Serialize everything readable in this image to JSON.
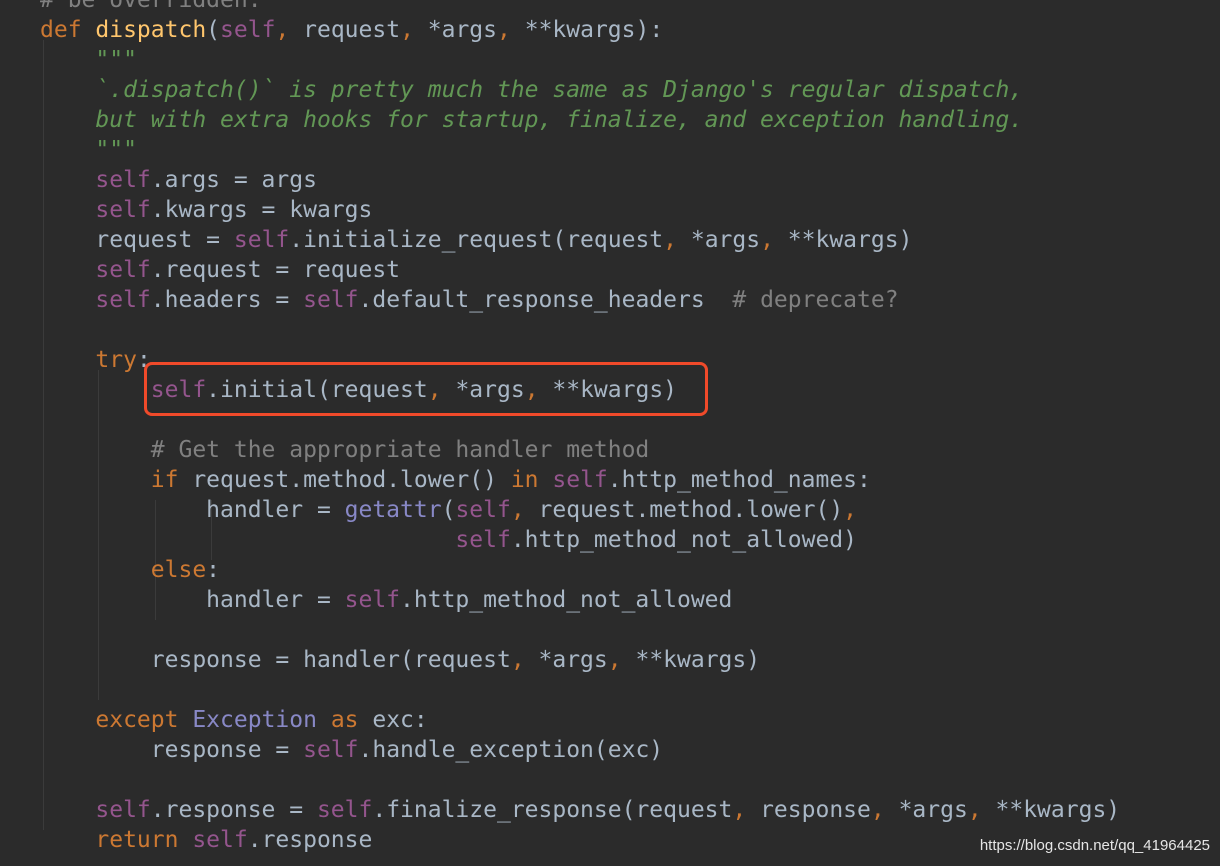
{
  "code_lines": [
    {
      "tokens": [
        {
          "t": "# be overridden.",
          "c": "cm"
        }
      ]
    },
    {
      "tokens": [
        {
          "t": "def ",
          "c": "kw"
        },
        {
          "t": "dispatch",
          "c": "fn"
        },
        {
          "t": "(",
          "c": ""
        },
        {
          "t": "self",
          "c": "sf"
        },
        {
          "t": ", ",
          "c": "kw"
        },
        {
          "t": "request",
          "c": ""
        },
        {
          "t": ", ",
          "c": "kw"
        },
        {
          "t": "*args",
          "c": ""
        },
        {
          "t": ", ",
          "c": "kw"
        },
        {
          "t": "**kwargs",
          "c": ""
        },
        {
          "t": "):",
          "c": ""
        }
      ]
    },
    {
      "tokens": [
        {
          "t": "    \"\"\"",
          "c": "doc"
        }
      ]
    },
    {
      "tokens": [
        {
          "t": "    `.dispatch()` is pretty much the same as Django's regular dispatch,",
          "c": "doc"
        }
      ]
    },
    {
      "tokens": [
        {
          "t": "    but with extra hooks for startup, finalize, and exception handling.",
          "c": "doc"
        }
      ]
    },
    {
      "tokens": [
        {
          "t": "    \"\"\"",
          "c": "doc"
        }
      ]
    },
    {
      "tokens": [
        {
          "t": "    ",
          "c": ""
        },
        {
          "t": "self",
          "c": "sf"
        },
        {
          "t": ".args = args",
          "c": ""
        }
      ]
    },
    {
      "tokens": [
        {
          "t": "    ",
          "c": ""
        },
        {
          "t": "self",
          "c": "sf"
        },
        {
          "t": ".kwargs = kwargs",
          "c": ""
        }
      ]
    },
    {
      "tokens": [
        {
          "t": "    request = ",
          "c": ""
        },
        {
          "t": "self",
          "c": "sf"
        },
        {
          "t": ".initialize_request(request",
          "c": ""
        },
        {
          "t": ", ",
          "c": "kw"
        },
        {
          "t": "*args",
          "c": ""
        },
        {
          "t": ", ",
          "c": "kw"
        },
        {
          "t": "**kwargs)",
          "c": ""
        }
      ]
    },
    {
      "tokens": [
        {
          "t": "    ",
          "c": ""
        },
        {
          "t": "self",
          "c": "sf"
        },
        {
          "t": ".request = request",
          "c": ""
        }
      ]
    },
    {
      "tokens": [
        {
          "t": "    ",
          "c": ""
        },
        {
          "t": "self",
          "c": "sf"
        },
        {
          "t": ".headers = ",
          "c": ""
        },
        {
          "t": "self",
          "c": "sf"
        },
        {
          "t": ".default_response_headers  ",
          "c": ""
        },
        {
          "t": "# deprecate?",
          "c": "cm"
        }
      ]
    },
    {
      "tokens": []
    },
    {
      "tokens": [
        {
          "t": "    ",
          "c": ""
        },
        {
          "t": "try",
          "c": "kw"
        },
        {
          "t": ":",
          "c": ""
        }
      ]
    },
    {
      "tokens": [
        {
          "t": "        ",
          "c": ""
        },
        {
          "t": "self",
          "c": "sf"
        },
        {
          "t": ".initial(request",
          "c": ""
        },
        {
          "t": ", ",
          "c": "kw"
        },
        {
          "t": "*args",
          "c": ""
        },
        {
          "t": ", ",
          "c": "kw"
        },
        {
          "t": "**kwargs)",
          "c": ""
        }
      ]
    },
    {
      "tokens": []
    },
    {
      "tokens": [
        {
          "t": "        # Get the appropriate handler method",
          "c": "cm"
        }
      ]
    },
    {
      "tokens": [
        {
          "t": "        ",
          "c": ""
        },
        {
          "t": "if ",
          "c": "kw"
        },
        {
          "t": "request.method.lower() ",
          "c": ""
        },
        {
          "t": "in ",
          "c": "kw"
        },
        {
          "t": "self",
          "c": "sf"
        },
        {
          "t": ".http_method_names:",
          "c": ""
        }
      ]
    },
    {
      "tokens": [
        {
          "t": "            handler = ",
          "c": ""
        },
        {
          "t": "getattr",
          "c": "bi"
        },
        {
          "t": "(",
          "c": ""
        },
        {
          "t": "self",
          "c": "sf"
        },
        {
          "t": ", ",
          "c": "kw"
        },
        {
          "t": "request.method.lower()",
          "c": ""
        },
        {
          "t": ",",
          "c": "kw"
        }
      ]
    },
    {
      "tokens": [
        {
          "t": "                              ",
          "c": ""
        },
        {
          "t": "self",
          "c": "sf"
        },
        {
          "t": ".http_method_not_allowed)",
          "c": ""
        }
      ]
    },
    {
      "tokens": [
        {
          "t": "        ",
          "c": ""
        },
        {
          "t": "else",
          "c": "kw"
        },
        {
          "t": ":",
          "c": ""
        }
      ]
    },
    {
      "tokens": [
        {
          "t": "            handler = ",
          "c": ""
        },
        {
          "t": "self",
          "c": "sf"
        },
        {
          "t": ".http_method_not_allowed",
          "c": ""
        }
      ]
    },
    {
      "tokens": []
    },
    {
      "tokens": [
        {
          "t": "        response = handler(request",
          "c": ""
        },
        {
          "t": ", ",
          "c": "kw"
        },
        {
          "t": "*args",
          "c": ""
        },
        {
          "t": ", ",
          "c": "kw"
        },
        {
          "t": "**kwargs)",
          "c": ""
        }
      ]
    },
    {
      "tokens": []
    },
    {
      "tokens": [
        {
          "t": "    ",
          "c": ""
        },
        {
          "t": "except ",
          "c": "kw"
        },
        {
          "t": "Exception ",
          "c": "ex"
        },
        {
          "t": "as ",
          "c": "kw"
        },
        {
          "t": "exc:",
          "c": ""
        }
      ]
    },
    {
      "tokens": [
        {
          "t": "        response = ",
          "c": ""
        },
        {
          "t": "self",
          "c": "sf"
        },
        {
          "t": ".handle_exception(exc)",
          "c": ""
        }
      ]
    },
    {
      "tokens": []
    },
    {
      "tokens": [
        {
          "t": "    ",
          "c": ""
        },
        {
          "t": "self",
          "c": "sf"
        },
        {
          "t": ".response = ",
          "c": ""
        },
        {
          "t": "self",
          "c": "sf"
        },
        {
          "t": ".finalize_response(request",
          "c": ""
        },
        {
          "t": ", ",
          "c": "kw"
        },
        {
          "t": "response",
          "c": ""
        },
        {
          "t": ", ",
          "c": "kw"
        },
        {
          "t": "*args",
          "c": ""
        },
        {
          "t": ", ",
          "c": "kw"
        },
        {
          "t": "**kwargs)",
          "c": ""
        }
      ]
    },
    {
      "tokens": [
        {
          "t": "    ",
          "c": ""
        },
        {
          "t": "return ",
          "c": "kw"
        },
        {
          "t": "self",
          "c": "sf"
        },
        {
          "t": ".response",
          "c": ""
        }
      ]
    }
  ],
  "watermark": "https://blog.csdn.net/qq_41964425",
  "colors": {
    "background": "#2b2b2b",
    "keyword": "#cc7832",
    "function": "#ffc66d",
    "self": "#94558d",
    "comment": "#808080",
    "docstring": "#629755",
    "highlight_box": "#f04a2a"
  }
}
